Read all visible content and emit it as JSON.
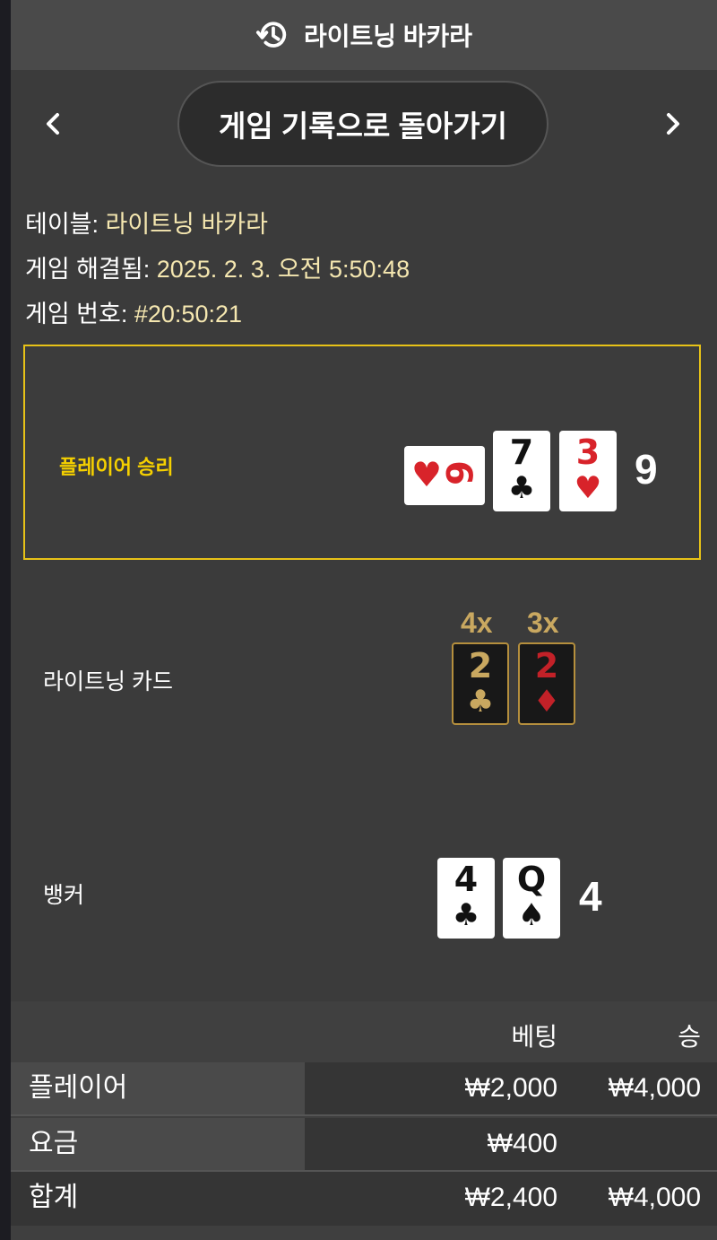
{
  "header": {
    "title": "라이트닝 바카라",
    "icon": "history-icon"
  },
  "nav": {
    "back_label": "게임 기록으로 돌아가기",
    "prev_icon": "chevron-left-icon",
    "next_icon": "chevron-right-icon"
  },
  "info": {
    "table_label": "테이블: ",
    "table_value": "라이트닝 바카라",
    "resolved_label": "게임 해결됨: ",
    "resolved_value": "2025. 2. 3. 오전 5:50:48",
    "number_label": "게임 번호: ",
    "number_value": "#20:50:21"
  },
  "player": {
    "result": "플레이어 승리",
    "cards": [
      {
        "rank": "6",
        "suit": "♥",
        "color": "red",
        "sideways": true
      },
      {
        "rank": "7",
        "suit": "♣",
        "color": "black"
      },
      {
        "rank": "3",
        "suit": "♥",
        "color": "red"
      }
    ],
    "total": "9"
  },
  "lightning": {
    "label": "라이트닝 카드",
    "cards": [
      {
        "multiplier": "4x",
        "rank": "2",
        "suit": "♣"
      },
      {
        "multiplier": "3x",
        "rank": "2",
        "suit": "♦"
      }
    ]
  },
  "banker": {
    "label": "뱅커",
    "cards": [
      {
        "rank": "4",
        "suit": "♣"
      },
      {
        "rank": "Q",
        "suit": "♠"
      }
    ],
    "total": "4"
  },
  "table": {
    "headers": {
      "bet": "베팅",
      "win": "승"
    },
    "rows": [
      {
        "label": "플레이어",
        "bet": "₩2,000",
        "win": "₩4,000"
      },
      {
        "label": "요금",
        "bet": "₩400",
        "win": ""
      },
      {
        "label": "합계",
        "bet": "₩2,400",
        "win": "₩4,000"
      }
    ]
  },
  "colors": {
    "accent": "#e7c217",
    "win_label": "#f5d000",
    "value_text": "#f5e7b0",
    "lightning_gold": "#c9a860"
  }
}
